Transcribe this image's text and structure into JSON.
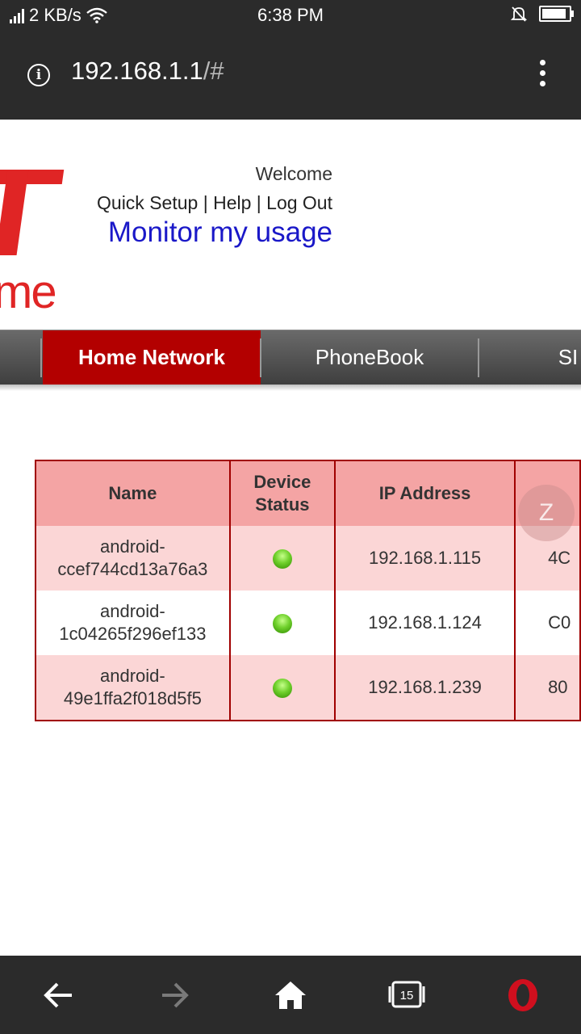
{
  "status_bar": {
    "network_speed": "2 KB/s",
    "time": "6:38 PM",
    "battery_level": 0.9
  },
  "browser": {
    "url_main": "192.168.1.1",
    "url_tail": "/#",
    "tab_count": "15"
  },
  "header": {
    "welcome": "Welcome",
    "links": [
      "Quick Setup",
      "Help",
      "Log Out"
    ],
    "monitor_link": "Monitor my usage"
  },
  "nav": {
    "tabs": [
      "Home Network",
      "PhoneBook",
      "SI"
    ],
    "active": "Home Network"
  },
  "device_table": {
    "headers": [
      "Name",
      "Device Status",
      "IP Address"
    ],
    "header_name": "Name",
    "header_status_line1": "Device",
    "header_status_line2": "Status",
    "header_ip": "IP Address",
    "rows": [
      {
        "name_line1": "android-",
        "name_line2": "ccef744cd13a76a3",
        "status": "online",
        "ip": "192.168.1.115",
        "mac_partial": "4C"
      },
      {
        "name_line1": "android-",
        "name_line2": "1c04265f296ef133",
        "status": "online",
        "ip": "192.168.1.124",
        "mac_partial": "C0"
      },
      {
        "name_line1": "android-",
        "name_line2": "49e1ffa2f018d5f5",
        "status": "online",
        "ip": "192.168.1.239",
        "mac_partial": "80"
      }
    ]
  },
  "floating_bubble": "Z",
  "colors": {
    "brand_red": "#b30000",
    "link_blue": "#1a18c8",
    "table_header": "#f4a4a4",
    "table_row_alt": "#fbd6d6"
  }
}
